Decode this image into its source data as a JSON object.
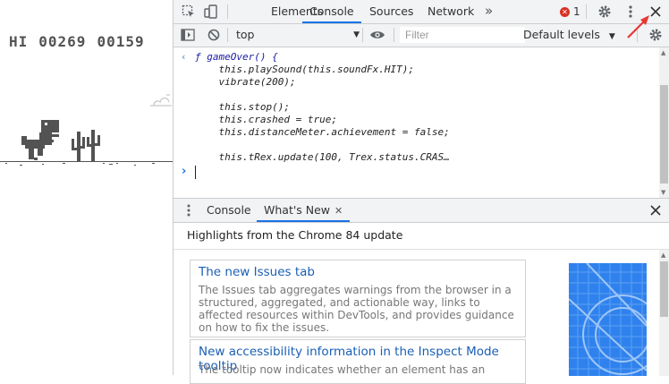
{
  "game": {
    "hi_label": "HI",
    "hi_score": "00269",
    "current_score": "00159"
  },
  "devtools": {
    "tabs": [
      "Elements",
      "Console",
      "Sources",
      "Network"
    ],
    "active_tab": "Console",
    "more_tabs_icon": "chevron-double-right-icon",
    "error_count": "1",
    "console_toolbar": {
      "context": "top",
      "filter_placeholder": "Filter",
      "levels": "Default levels"
    },
    "console_output": {
      "lines": [
        "ƒ gameOver() {",
        "    this.playSound(this.soundFx.HIT);",
        "    vibrate(200);",
        "",
        "    this.stop();",
        "    this.crashed = true;",
        "    this.distanceMeter.achievement = false;",
        "",
        "    this.tRex.update(100, Trex.status.CRAS…"
      ]
    },
    "drawer": {
      "tabs": [
        "Console",
        "What's New"
      ],
      "active_tab": "What's New",
      "highlights": "Highlights from the Chrome 84 update",
      "cards": [
        {
          "title": "The new Issues tab",
          "description": "The Issues tab aggregates warnings from the browser in a structured, aggregated, and actionable way, links to affected resources within DevTools, and provides guidance on how to fix the issues."
        },
        {
          "title": "New accessibility information in the Inspect Mode tooltip",
          "description": "The tooltip now indicates whether an element has an"
        }
      ]
    }
  },
  "colors": {
    "accent": "#1a73e8",
    "error": "#d93025",
    "link": "#1a5fb4",
    "annotation_arrow": "#e53935",
    "game_gray": "#535353",
    "hero_blue": "#2f82ed"
  }
}
